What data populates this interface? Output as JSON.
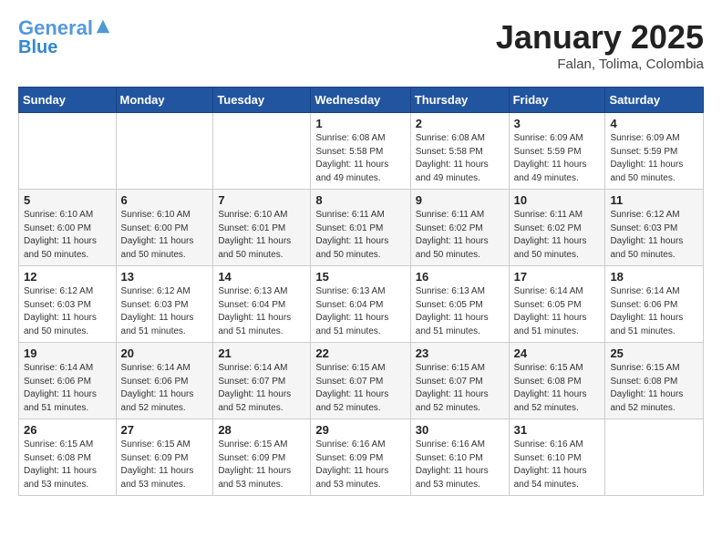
{
  "header": {
    "logo_line1": "General",
    "logo_line2": "Blue",
    "month_title": "January 2025",
    "location": "Falan, Tolima, Colombia"
  },
  "weekdays": [
    "Sunday",
    "Monday",
    "Tuesday",
    "Wednesday",
    "Thursday",
    "Friday",
    "Saturday"
  ],
  "weeks": [
    [
      {
        "day": "",
        "info": ""
      },
      {
        "day": "",
        "info": ""
      },
      {
        "day": "",
        "info": ""
      },
      {
        "day": "1",
        "info": "Sunrise: 6:08 AM\nSunset: 5:58 PM\nDaylight: 11 hours\nand 49 minutes."
      },
      {
        "day": "2",
        "info": "Sunrise: 6:08 AM\nSunset: 5:58 PM\nDaylight: 11 hours\nand 49 minutes."
      },
      {
        "day": "3",
        "info": "Sunrise: 6:09 AM\nSunset: 5:59 PM\nDaylight: 11 hours\nand 49 minutes."
      },
      {
        "day": "4",
        "info": "Sunrise: 6:09 AM\nSunset: 5:59 PM\nDaylight: 11 hours\nand 50 minutes."
      }
    ],
    [
      {
        "day": "5",
        "info": "Sunrise: 6:10 AM\nSunset: 6:00 PM\nDaylight: 11 hours\nand 50 minutes."
      },
      {
        "day": "6",
        "info": "Sunrise: 6:10 AM\nSunset: 6:00 PM\nDaylight: 11 hours\nand 50 minutes."
      },
      {
        "day": "7",
        "info": "Sunrise: 6:10 AM\nSunset: 6:01 PM\nDaylight: 11 hours\nand 50 minutes."
      },
      {
        "day": "8",
        "info": "Sunrise: 6:11 AM\nSunset: 6:01 PM\nDaylight: 11 hours\nand 50 minutes."
      },
      {
        "day": "9",
        "info": "Sunrise: 6:11 AM\nSunset: 6:02 PM\nDaylight: 11 hours\nand 50 minutes."
      },
      {
        "day": "10",
        "info": "Sunrise: 6:11 AM\nSunset: 6:02 PM\nDaylight: 11 hours\nand 50 minutes."
      },
      {
        "day": "11",
        "info": "Sunrise: 6:12 AM\nSunset: 6:03 PM\nDaylight: 11 hours\nand 50 minutes."
      }
    ],
    [
      {
        "day": "12",
        "info": "Sunrise: 6:12 AM\nSunset: 6:03 PM\nDaylight: 11 hours\nand 50 minutes."
      },
      {
        "day": "13",
        "info": "Sunrise: 6:12 AM\nSunset: 6:03 PM\nDaylight: 11 hours\nand 51 minutes."
      },
      {
        "day": "14",
        "info": "Sunrise: 6:13 AM\nSunset: 6:04 PM\nDaylight: 11 hours\nand 51 minutes."
      },
      {
        "day": "15",
        "info": "Sunrise: 6:13 AM\nSunset: 6:04 PM\nDaylight: 11 hours\nand 51 minutes."
      },
      {
        "day": "16",
        "info": "Sunrise: 6:13 AM\nSunset: 6:05 PM\nDaylight: 11 hours\nand 51 minutes."
      },
      {
        "day": "17",
        "info": "Sunrise: 6:14 AM\nSunset: 6:05 PM\nDaylight: 11 hours\nand 51 minutes."
      },
      {
        "day": "18",
        "info": "Sunrise: 6:14 AM\nSunset: 6:06 PM\nDaylight: 11 hours\nand 51 minutes."
      }
    ],
    [
      {
        "day": "19",
        "info": "Sunrise: 6:14 AM\nSunset: 6:06 PM\nDaylight: 11 hours\nand 51 minutes."
      },
      {
        "day": "20",
        "info": "Sunrise: 6:14 AM\nSunset: 6:06 PM\nDaylight: 11 hours\nand 52 minutes."
      },
      {
        "day": "21",
        "info": "Sunrise: 6:14 AM\nSunset: 6:07 PM\nDaylight: 11 hours\nand 52 minutes."
      },
      {
        "day": "22",
        "info": "Sunrise: 6:15 AM\nSunset: 6:07 PM\nDaylight: 11 hours\nand 52 minutes."
      },
      {
        "day": "23",
        "info": "Sunrise: 6:15 AM\nSunset: 6:07 PM\nDaylight: 11 hours\nand 52 minutes."
      },
      {
        "day": "24",
        "info": "Sunrise: 6:15 AM\nSunset: 6:08 PM\nDaylight: 11 hours\nand 52 minutes."
      },
      {
        "day": "25",
        "info": "Sunrise: 6:15 AM\nSunset: 6:08 PM\nDaylight: 11 hours\nand 52 minutes."
      }
    ],
    [
      {
        "day": "26",
        "info": "Sunrise: 6:15 AM\nSunset: 6:08 PM\nDaylight: 11 hours\nand 53 minutes."
      },
      {
        "day": "27",
        "info": "Sunrise: 6:15 AM\nSunset: 6:09 PM\nDaylight: 11 hours\nand 53 minutes."
      },
      {
        "day": "28",
        "info": "Sunrise: 6:15 AM\nSunset: 6:09 PM\nDaylight: 11 hours\nand 53 minutes."
      },
      {
        "day": "29",
        "info": "Sunrise: 6:16 AM\nSunset: 6:09 PM\nDaylight: 11 hours\nand 53 minutes."
      },
      {
        "day": "30",
        "info": "Sunrise: 6:16 AM\nSunset: 6:10 PM\nDaylight: 11 hours\nand 53 minutes."
      },
      {
        "day": "31",
        "info": "Sunrise: 6:16 AM\nSunset: 6:10 PM\nDaylight: 11 hours\nand 54 minutes."
      },
      {
        "day": "",
        "info": ""
      }
    ]
  ]
}
